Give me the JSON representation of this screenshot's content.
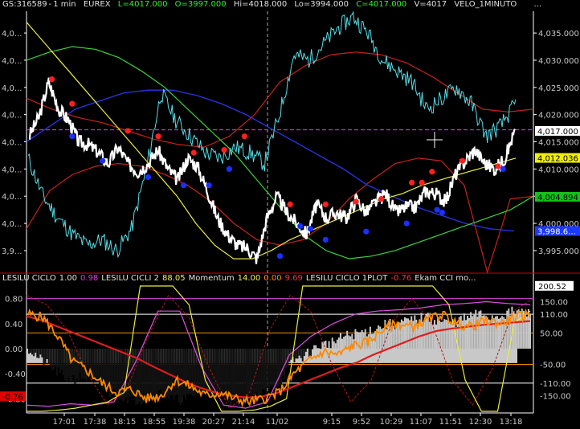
{
  "header": {
    "symbol": "GS:316589",
    "interval": "1 min",
    "exchange": "EUREX",
    "last": "L=4017.000",
    "open": "O=3997.000",
    "high": "Hi=4018.000",
    "low": "Lo=3994.000",
    "close": "C=4017.000",
    "volume": "V=4017",
    "study": "VELO_1MINUTO",
    "dots": "..."
  },
  "subheader": [
    {
      "text": "LESILU CICLO",
      "color": "#e0e0e0"
    },
    {
      "text": "1.00",
      "color": "#e0e0e0"
    },
    {
      "text": "0.98",
      "color": "#e040e0"
    },
    {
      "text": "LESILU CICLI 2",
      "color": "#e0e0e0"
    },
    {
      "text": "88.05",
      "color": "#f0f060"
    },
    {
      "text": "Momentum",
      "color": "#e0e0e0"
    },
    {
      "text": "14.00",
      "color": "#f0f060"
    },
    {
      "text": "0.00",
      "color": "#ff8a00"
    },
    {
      "text": "9.69",
      "color": "#ff3030"
    },
    {
      "text": "LESILU CICLO 1PLOT",
      "color": "#e0e0e0"
    },
    {
      "text": "-0.76",
      "color": "#ff3030"
    },
    {
      "text": "Ekam CCI mo...",
      "color": "#e0e0e0"
    }
  ],
  "colors": {
    "background": "#000000",
    "price": "#ffffff",
    "cyan": "#55dde6",
    "blue": "#2b34e8",
    "yellow": "#ecec3a",
    "green": "#3ad23a",
    "red": "#c8221c",
    "dotRed": "#ff2020",
    "dotBlue": "#1a30ff",
    "orange": "#ff8a00",
    "magenta": "#e050e0",
    "gray": "#c8c8c8"
  },
  "chart_data": {
    "type": "line",
    "x_ticks": [
      "17:01",
      "17:38",
      "18:15",
      "18:55",
      "19:38",
      "20:27",
      "21:14",
      "11/02",
      "9:15",
      "9:52",
      "10:29",
      "11:07",
      "11:51",
      "12:30",
      "13:18"
    ],
    "upper": {
      "left_axis_ticks": [
        "4,0...",
        "4,0...",
        "4,0...",
        "4,0...",
        "4,0...",
        "4,0...",
        "4,0...",
        "4,0...",
        "3,9..."
      ],
      "right_axis_ticks": [
        "4,035.000",
        "4,030.000",
        "4,025.000",
        "4,020.000",
        "4,015.000",
        "4,010.000",
        "4,005.000",
        "4,000.000",
        "3,995.000"
      ],
      "tick_values": [
        4035,
        4030,
        4025,
        4020,
        4015,
        4010,
        4005,
        4000,
        3995
      ],
      "ylim": [
        3991,
        4039
      ],
      "marker_labels": [
        {
          "text": "4,017.000",
          "value": 4017,
          "bg": "#ffffff",
          "fg": "#000000"
        },
        {
          "text": "4,012.036",
          "value": 4012.036,
          "bg": "#f0f000",
          "fg": "#000000"
        },
        {
          "text": "4,004.894",
          "value": 4004.894,
          "bg": "#12c21a",
          "fg": "#000000"
        },
        {
          "text": "3,998.6...",
          "value": 3998.6,
          "bg": "#1c3aff",
          "fg": "#ffffff"
        }
      ],
      "price_close": [
        4016.0,
        4019.5,
        4026.0,
        4021.0,
        4019.0,
        4015.0,
        4014.5,
        4013.0,
        4011.0,
        4014.0,
        4011.0,
        4009.5,
        4011.0,
        4013.5,
        4010.0,
        4008.0,
        4012.0,
        4010.5,
        4006.0,
        4001.0,
        3998.0,
        3996.0,
        3995.5,
        3993.5,
        4001.0,
        4005.0,
        4002.0,
        4000.0,
        3998.0,
        4003.5,
        4001.0,
        4002.0,
        4001.0,
        4004.5,
        4002.0,
        4004.0,
        4005.5,
        4002.0,
        4003.0,
        4003.0,
        4006.0,
        4005.5,
        4004.0,
        4009.0,
        4011.5,
        4013.5,
        4011.0,
        4010.0,
        4012.0,
        4017.0
      ],
      "price_extremes_min": 3993.5,
      "price_extremes_max": 4026.5,
      "cyan": [
        4012,
        4005,
        4001,
        3998,
        3996,
        3997,
        3995,
        3999,
        4010,
        4024,
        4019,
        4016,
        4013,
        4012,
        4014,
        4013,
        4011,
        4020,
        4031,
        4030,
        4033,
        4036,
        4038,
        4035,
        4030,
        4028,
        4026,
        4021,
        4023,
        4025,
        4022,
        4016,
        4018,
        4022
      ],
      "yellow": [
        4037,
        4033,
        4029,
        4025,
        4021,
        4017,
        4013,
        4009,
        4005,
        4000,
        3996,
        3993.5,
        3993.5,
        3995,
        3997,
        3998.5,
        4000,
        4001.5,
        4003,
        4004.5,
        4005.5,
        4007,
        4008,
        4009,
        4010,
        4011,
        4012
      ],
      "green": [
        4030,
        4031.5,
        4032.5,
        4032,
        4030.5,
        4028,
        4025,
        4021,
        4017,
        4013,
        4008,
        4003,
        3998,
        3995,
        3993.5,
        3994,
        3995,
        3996.5,
        3998,
        3999.5,
        4001,
        4002.5,
        4005
      ],
      "blue": [
        4015,
        4018,
        4021,
        4022.5,
        4024,
        4024.5,
        4024.5,
        4023.5,
        4022,
        4020,
        4017.5,
        4015,
        4012.5,
        4010,
        4007,
        4005,
        4003,
        4001.5,
        4000,
        3999,
        3998.6
      ],
      "red_upper": [
        4023,
        4021,
        4019.5,
        4018.5,
        4017,
        4015.5,
        4014.5,
        4014,
        4016,
        4020,
        4026,
        4029,
        4031,
        4031.5,
        4031,
        4029.5,
        4027,
        4024,
        4021,
        4020.5,
        4021
      ],
      "red_lower": [
        3999,
        4006,
        4009,
        4010.5,
        4011,
        4010.5,
        4009,
        4007,
        4004,
        4000,
        3997,
        3996,
        3997,
        4000,
        4004.5,
        4008,
        4011,
        4012,
        4011.5,
        4007,
        3991,
        4004.5,
        4005
      ],
      "magenta_ref": 4017.2,
      "dots_red": [
        [
          4026.5,
          0.05
        ],
        [
          4022,
          0.09
        ],
        [
          4017,
          0.2
        ],
        [
          4016,
          0.26
        ],
        [
          4013,
          0.33
        ],
        [
          4013.5,
          0.39
        ],
        [
          4016,
          0.43
        ],
        [
          4003.5,
          0.52
        ],
        [
          4003.5,
          0.59
        ],
        [
          4004,
          0.65
        ],
        [
          4004.5,
          0.7
        ],
        [
          4007.5,
          0.76
        ],
        [
          4007.5,
          0.78
        ],
        [
          4009.5,
          0.8
        ],
        [
          4011.5,
          0.86
        ],
        [
          4010.5,
          0.93
        ]
      ],
      "dots_blue": [
        [
          4016,
          0.09
        ],
        [
          4011.5,
          0.15
        ],
        [
          4008.5,
          0.24
        ],
        [
          4007,
          0.31
        ],
        [
          4007,
          0.36
        ],
        [
          4010,
          0.4
        ],
        [
          3994,
          0.5
        ],
        [
          3999.5,
          0.54
        ],
        [
          3999,
          0.56
        ],
        [
          3997,
          0.59
        ],
        [
          3998.5,
          0.67
        ],
        [
          4000,
          0.75
        ],
        [
          4002.5,
          0.81
        ],
        [
          4002,
          0.82
        ],
        [
          4010,
          0.94
        ]
      ]
    },
    "lower": {
      "left_axis_ticks": [
        "0.80",
        "0.40",
        "0.00",
        "-0.40",
        "-0.80"
      ],
      "left_tick_values": [
        0.8,
        0.4,
        0.0,
        -0.4,
        -0.8
      ],
      "right_axis_ticks": [
        "150.00",
        "110.00",
        "50.00",
        "-50.00",
        "-110.00",
        "-150.00"
      ],
      "right_tick_values": [
        150,
        110,
        50,
        -50,
        -110,
        -150
      ],
      "ylim_left": [
        -1.0,
        1.0
      ],
      "ylim_right": [
        -200,
        200
      ],
      "marker_labels": [
        {
          "text": "200.52",
          "value": 200.52,
          "side": "right",
          "bg": "#ffffff",
          "fg": "#000000"
        },
        {
          "text": "-0.76",
          "value": -0.76,
          "side": "left",
          "bg": "#e00000",
          "fg": "#000000"
        }
      ],
      "histogram": [
        0.0,
        -0.2,
        -0.35,
        -0.5,
        -0.45,
        -0.55,
        -0.7,
        -0.75,
        -0.82,
        -0.8,
        -0.7,
        -0.82,
        -0.8,
        -0.7,
        -0.72,
        -0.8,
        -0.85,
        -0.78,
        -0.7,
        -0.55,
        -0.2,
        -0.1,
        0.05,
        0.1,
        0.2,
        0.25,
        0.3,
        0.38,
        0.4,
        0.45,
        0.5,
        0.45,
        0.4,
        0.48,
        0.55,
        0.5,
        0.55,
        0.6,
        0.55
      ],
      "red_line": [
        0.52,
        0.45,
        0.35,
        0.25,
        0.15,
        0.05,
        -0.05,
        -0.15,
        -0.28,
        -0.4,
        -0.52,
        -0.62,
        -0.7,
        -0.75,
        -0.78,
        -0.76,
        -0.7,
        -0.6,
        -0.5,
        -0.4,
        -0.3,
        -0.22,
        -0.1,
        0.0,
        0.1,
        0.2,
        0.28,
        0.32,
        0.35,
        0.38,
        0.4,
        0.42,
        0.44
      ],
      "orange_line": [
        0.55,
        0.5,
        0.2,
        -0.2,
        -0.35,
        -0.55,
        -0.7,
        -0.65,
        -0.8,
        -0.75,
        -0.5,
        -0.6,
        -0.75,
        -0.7,
        -0.8,
        -0.85,
        -0.8,
        -0.7,
        -0.4,
        -0.2,
        -0.05,
        -0.1,
        0.05,
        0.1,
        0.3,
        0.4,
        0.35,
        0.45,
        0.55,
        0.4,
        0.35,
        0.45,
        0.4,
        0.5,
        0.55
      ],
      "yellow_cycle": [
        -1.0,
        -1.0,
        -0.98,
        -0.95,
        -0.9,
        -0.85,
        -0.7,
        1.0,
        1.0,
        1.0,
        0.7,
        -0.5,
        -1.0,
        -1.0,
        -0.98,
        -0.92,
        -0.8,
        1.0,
        1.0,
        1.0,
        1.0,
        1.0,
        1.0,
        1.0,
        1.0,
        1.0,
        0.7,
        -0.5,
        -1.0,
        -1.0,
        0.4,
        0.6
      ],
      "magenta_cycle": [
        -0.9,
        -0.92,
        -0.88,
        -0.9,
        -0.85,
        -0.2,
        0.6,
        0.6,
        -0.3,
        -0.9,
        -0.95,
        -0.85,
        -0.1,
        0.2,
        0.4,
        0.55,
        0.6,
        0.62,
        0.65,
        0.7,
        0.72,
        0.75,
        0.72,
        0.7
      ],
      "red_dashed_cycle": [
        0.85,
        0.7,
        0.3,
        -0.4,
        -0.9,
        -0.6,
        0.2,
        0.85,
        0.5,
        -0.3,
        -0.95,
        -0.7,
        0.3,
        0.85,
        0.6,
        -0.2,
        -0.85,
        -0.5,
        0.4,
        0.8,
        0.4,
        -0.5,
        -0.9,
        -0.3,
        0.6,
        0.8
      ]
    }
  }
}
